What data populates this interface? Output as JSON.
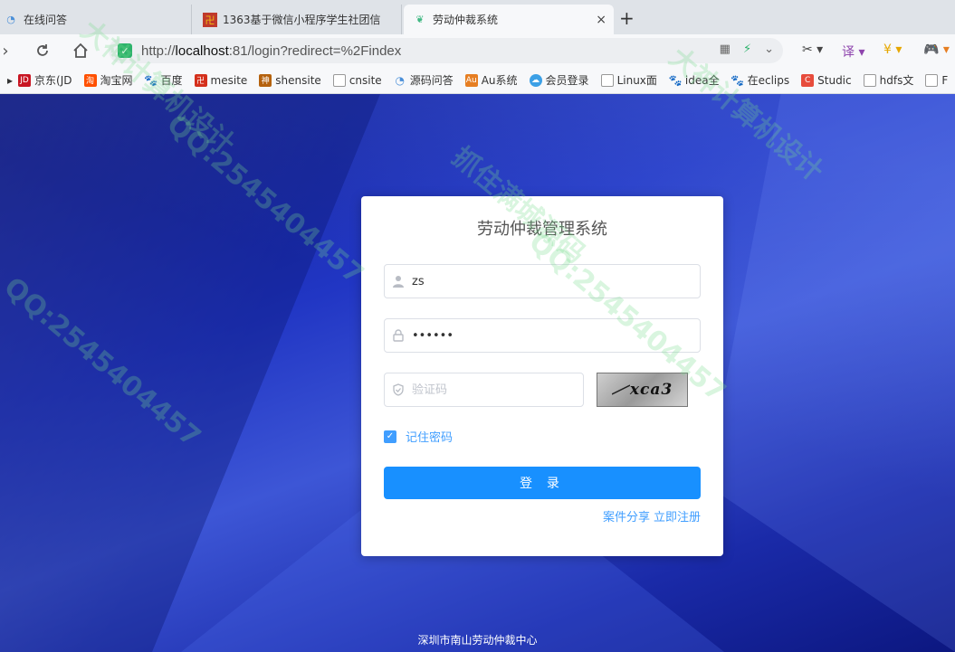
{
  "browser": {
    "tabs": [
      {
        "title": "在线问答",
        "active": false
      },
      {
        "title": "1363基于微信小程序学生社团信",
        "active": false
      },
      {
        "title": "劳动仲裁系统",
        "active": true
      }
    ],
    "new_tab": "+",
    "close": "×",
    "url_prefix": "http://",
    "url_host": "localhost",
    "url_rest": ":81/login?redirect=%2Findex",
    "bookmarks": [
      {
        "label": "京东(JD",
        "icon": "jd-icon",
        "color": "#c81623"
      },
      {
        "label": "淘宝网",
        "icon": "taobao-icon",
        "color": "#ff5000"
      },
      {
        "label": "百度",
        "icon": "baidu-paw-icon",
        "color": "#2932e1"
      },
      {
        "label": "mesite",
        "icon": "mesite-icon",
        "color": "#d4301c"
      },
      {
        "label": "shensite",
        "icon": "shensite-icon",
        "color": "#b5620e"
      },
      {
        "label": "cnsite",
        "icon": "page-icon",
        "color": "#999999"
      },
      {
        "label": "源码问答",
        "icon": "qa-icon",
        "color": "#4a8fd8"
      },
      {
        "label": "Au系统",
        "icon": "au-icon",
        "color": "#e67e22"
      },
      {
        "label": "会员登录",
        "icon": "cloud-icon",
        "color": "#3ca0e6"
      },
      {
        "label": "Linux面",
        "icon": "page-icon",
        "color": "#999999"
      },
      {
        "label": "idea全",
        "icon": "baidu-paw-icon",
        "color": "#2932e1"
      },
      {
        "label": "在eclips",
        "icon": "baidu-paw-icon",
        "color": "#2932e1"
      },
      {
        "label": "Studic",
        "icon": "c-icon",
        "color": "#e74c3c"
      },
      {
        "label": "hdfs文",
        "icon": "page-icon",
        "color": "#999999"
      },
      {
        "label": "F",
        "icon": "page-icon",
        "color": "#999999"
      }
    ]
  },
  "login": {
    "title": "劳动仲裁管理系统",
    "username_value": "zs",
    "password_value": "••••••",
    "captcha_placeholder": "验证码",
    "captcha_text": "xca3",
    "remember_label": "记住密码",
    "login_label": "登 录",
    "link_share": "案件分享",
    "link_register": "立即注册"
  },
  "footer": "深圳市南山劳动仲裁中心",
  "watermarks": [
    "大神计算机设计",
    "QQ:2545404457",
    "抓住满城源码",
    "QQ:2545404457",
    "大神计算机设计",
    "QQ:2545404457"
  ]
}
